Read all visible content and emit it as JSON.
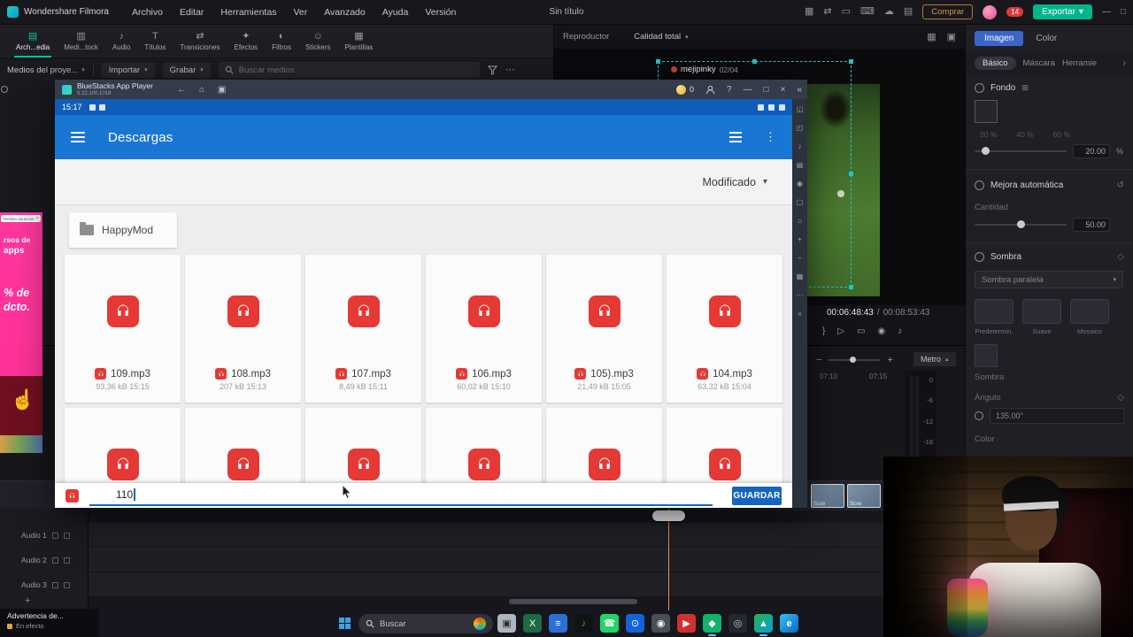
{
  "ui": {
    "caret_down": "▾",
    "caret_up": "▴",
    "dots_v": "⋮",
    "dots_h": "⋯",
    "chevron_right": "›",
    "minimize": "—",
    "maximize": "□",
    "close": "×",
    "collapse": "«",
    "reset": "↺",
    "diamond": "◇",
    "plus": "+",
    "minus": "−",
    "boxplus": "⊞"
  },
  "colors": {
    "accent": "#00c79c",
    "android_blue": "#1976d2",
    "file_red": "#e53935",
    "save_blue": "#1565c0",
    "ad_pink": "#ff37a0"
  },
  "menubar": {
    "logo": "Wondershare Filmora",
    "menus": [
      "Archivo",
      "Editar",
      "Herramientas",
      "Ver",
      "Avanzado",
      "Ayuda",
      "Versión"
    ],
    "doc_title": "Sin título",
    "icons": [
      {
        "name": "apps-icon",
        "glyph": "▦"
      },
      {
        "name": "sync-icon",
        "glyph": "⇄"
      },
      {
        "name": "mirror-icon",
        "glyph": "▭"
      },
      {
        "name": "keyboard-icon",
        "glyph": "⌨"
      },
      {
        "name": "cloud-icon",
        "glyph": "☁"
      },
      {
        "name": "layout-icon",
        "glyph": "▤"
      }
    ],
    "buy": "Comprar",
    "user_badge": "14",
    "export": "Exportar"
  },
  "media_panel": {
    "tabs": [
      {
        "label": "Arch...edia",
        "glyph": "▤"
      },
      {
        "label": "Medi...tock",
        "glyph": "▥"
      },
      {
        "label": "Audio",
        "glyph": "♪"
      },
      {
        "label": "Títulos",
        "glyph": "T"
      },
      {
        "label": "Transiciones",
        "glyph": "⇄"
      },
      {
        "label": "Efectos",
        "glyph": "✦"
      },
      {
        "label": "Filtros",
        "glyph": "◐"
      },
      {
        "label": "Stickers",
        "glyph": "☺"
      },
      {
        "label": "Plantillas",
        "glyph": "▦"
      }
    ],
    "library": "Medios del proye...",
    "import": "Importar",
    "record": "Grabar",
    "search_placeholder": "Buscar medios"
  },
  "preview": {
    "player_label": "Reproductor",
    "quality": "Calidad total",
    "grid_icon": "▦",
    "fit_icon": "▣",
    "overlay_user": "mejipinky",
    "overlay_count": "02/04",
    "tc_current": "00:06:48:43",
    "tc_sep": "/",
    "tc_total": "00:08:53:43",
    "ctrl_icons": [
      {
        "name": "mark-icon",
        "glyph": "}"
      },
      {
        "name": "flag-icon",
        "glyph": "▷"
      },
      {
        "name": "screen-icon",
        "glyph": "▭"
      },
      {
        "name": "snapshot-icon",
        "glyph": "◉"
      },
      {
        "name": "audio-icon",
        "glyph": "♪"
      }
    ]
  },
  "properties": {
    "tab_imagen": "Imagen",
    "tab_color": "Color",
    "subtab_basico": "Básico",
    "subtab_mascara": "Máscara",
    "subtab_herr": "Herramie",
    "fondo": "Fondo",
    "ticks": [
      "20 %",
      "40 %",
      "60 %"
    ],
    "scale_value": "20.00",
    "scale_unit": "%",
    "auto": "Mejora automática",
    "cantidad": "Cantidad",
    "cantidad_value": "50.00",
    "sombra": "Sombra",
    "sombra_paralela": "Sombra paralela",
    "presets": [
      "Predetermin.",
      "Suave",
      "Mosaico"
    ],
    "sombra_small": "Sombra",
    "angulo": "Ángulo",
    "angulo_value": "135.00°",
    "color_label": "Color"
  },
  "timeline": {
    "metro": "Metro",
    "ruler": [
      "07:10",
      "07:15"
    ],
    "db": [
      "0",
      "-6",
      "-12",
      "-18"
    ],
    "clip_caption": "Scre",
    "tracks": [
      "Audio 1",
      "Audio 2",
      "Audio 3"
    ]
  },
  "bluestacks": {
    "title": "BlueStacks App Player",
    "version": "5.22.100.1019",
    "back_icon": "←",
    "home_icon": "⌂",
    "shot_icon": "▣",
    "coin": "0",
    "help": "?",
    "sidebar_icons": [
      "◱",
      "◰",
      "♪",
      "▤",
      "◉",
      "▢",
      "⌂",
      "+",
      "−",
      "▦",
      "⋯",
      "«"
    ],
    "android": {
      "time": "15:17",
      "app_title": "Descargas",
      "sort": "Modificado",
      "folder": "HappyMod",
      "files": [
        {
          "name": "109.mp3",
          "meta": "93,36 kB 15:15"
        },
        {
          "name": "108.mp3",
          "meta": "207 kB 15:13"
        },
        {
          "name": "107.mp3",
          "meta": "8,49 kB 15:11"
        },
        {
          "name": "106.mp3",
          "meta": "60,02 kB 15:10"
        },
        {
          "name": "105).mp3",
          "meta": "21,49 kB 15:05"
        },
        {
          "name": "104.mp3",
          "meta": "63,32 kB 15:04"
        }
      ],
      "rename_value": "110",
      "save": "GUARDAR"
    }
  },
  "ad": {
    "header": "Gestión anuncios",
    "close": "✕",
    "line1": "rsos de",
    "line2": "apps",
    "line3": "% de",
    "line4": "dcto.",
    "hand": "☝"
  },
  "notification": {
    "title": "Advertencia de...",
    "subtitle": "En efecto"
  },
  "taskbar": {
    "search": "Buscar",
    "apps": [
      {
        "name": "screen-capture",
        "glyph": "▣"
      },
      {
        "name": "excel",
        "glyph": "X"
      },
      {
        "name": "mail",
        "glyph": "≡"
      },
      {
        "name": "spotify",
        "glyph": "♪"
      },
      {
        "name": "whatsapp",
        "glyph": "☎"
      },
      {
        "name": "clock",
        "glyph": "⊙"
      },
      {
        "name": "settings",
        "glyph": "◉"
      },
      {
        "name": "media-player",
        "glyph": "▶"
      },
      {
        "name": "filmora",
        "glyph": "◆"
      },
      {
        "name": "obs",
        "glyph": "◎"
      },
      {
        "name": "bluestacks",
        "glyph": "▲"
      },
      {
        "name": "edge",
        "glyph": "e"
      }
    ]
  }
}
